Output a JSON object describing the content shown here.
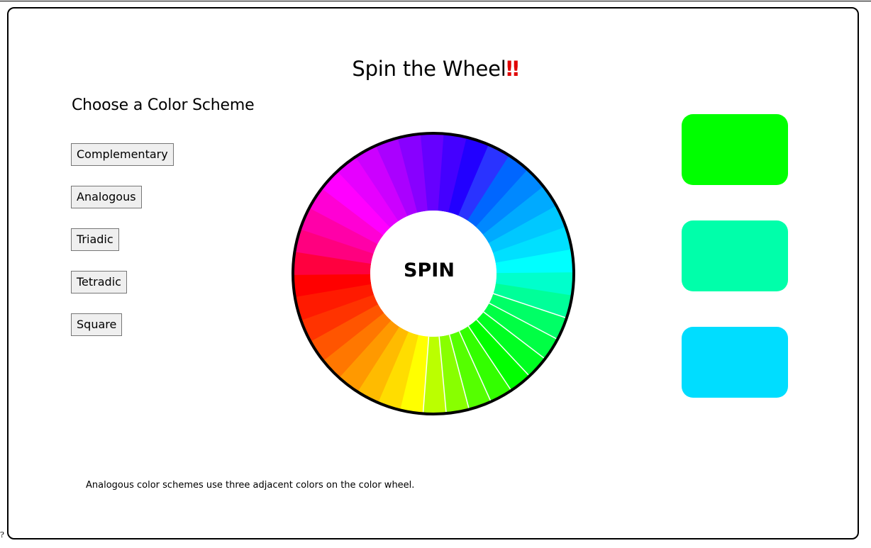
{
  "title": {
    "text": "Spin the Wheel",
    "emphasis": "‼"
  },
  "scheme_picker": {
    "heading": "Choose a Color Scheme",
    "buttons": [
      "Complementary",
      "Analogous",
      "Triadic",
      "Tetradic",
      "Square"
    ]
  },
  "wheel": {
    "center_label": "SPIN",
    "border_color": "#000000",
    "segments": [
      "#ff0000",
      "#ff003f",
      "#ff007f",
      "#ff00a8",
      "#ff00d4",
      "#ff00ff",
      "#e600ff",
      "#cc00ff",
      "#aa00ff",
      "#8800ff",
      "#6600ff",
      "#4400ff",
      "#2200ff",
      "#2a33ff",
      "#0066ff",
      "#0088ff",
      "#00aaff",
      "#00c8ff",
      "#00e0ff",
      "#00ffff",
      "#00ffcc",
      "#00ff99",
      "#00ff66",
      "#00ff44",
      "#00ff22",
      "#00ff00",
      "#33ff00",
      "#55ff00",
      "#88ff00",
      "#bbff00",
      "#ffff00",
      "#ffdd00",
      "#ffbb00",
      "#ff9900",
      "#ff7700",
      "#ff5500",
      "#ff3300",
      "#ff1a00"
    ],
    "white_dividers": [
      22,
      23,
      24,
      25,
      26,
      27,
      28,
      29,
      30
    ]
  },
  "swatches": [
    {
      "color": "#00ff00"
    },
    {
      "color": "#00ffaa"
    },
    {
      "color": "#00ddff"
    }
  ],
  "description": "Analogous color schemes use three adjacent colors on the color wheel.",
  "stray_glyph": "?"
}
